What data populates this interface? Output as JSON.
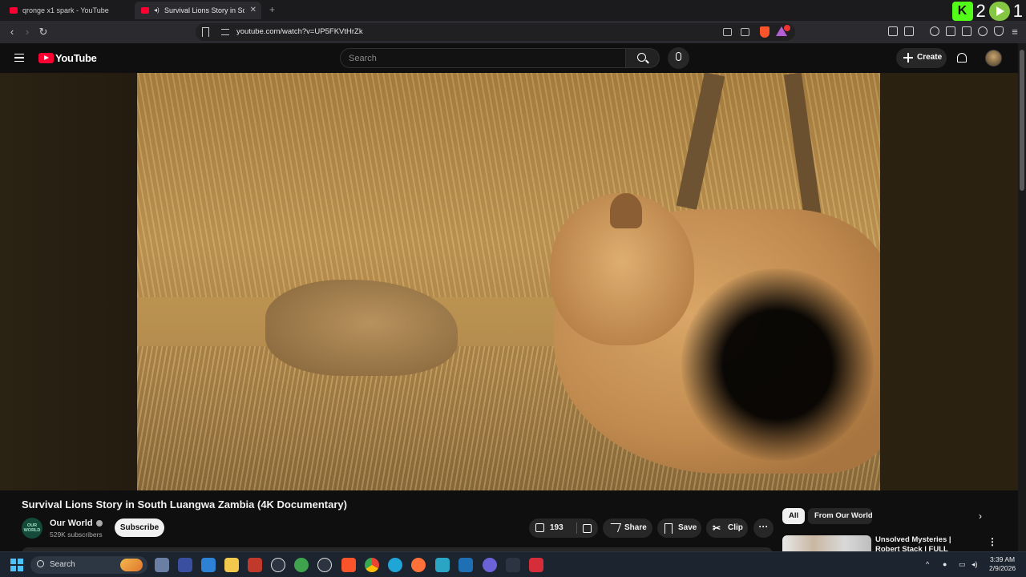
{
  "browser": {
    "tabs": [
      {
        "title": "qronge x1 spark - YouTube"
      },
      {
        "title": "Survival Lions Story in South L"
      }
    ],
    "url": "youtube.com/watch?v=UP5FKVtHrZk",
    "extension_counts": {
      "kick": "2",
      "rumble": "1"
    }
  },
  "youtube": {
    "logo_text": "YouTube",
    "search_placeholder": "Search",
    "create_label": "Create"
  },
  "video": {
    "title": "Survival Lions Story in South Luangwa Zambia (4K Documentary)",
    "channel": {
      "avatar_text": "OUR WORLD",
      "name": "Our World",
      "subscribers": "529K subscribers"
    },
    "subscribe_label": "Subscribe",
    "actions": {
      "likes": "193",
      "share_label": "Share",
      "save_label": "Save",
      "clip_label": "Clip",
      "more": "···"
    }
  },
  "sidebar": {
    "chips": [
      "All",
      "From Our World"
    ],
    "recommendations": [
      {
        "title": "Unsolved Mysteries | Robert Stack | FULL EPISODES |"
      }
    ]
  },
  "taskbar": {
    "search_label": "Search",
    "time": "3:39 AM",
    "date": "2/9/2026"
  },
  "colors": {
    "yt_red": "#ff0033",
    "background": "#0f0f0f",
    "kick_green": "#53fc18",
    "rumble_green": "#85c742"
  }
}
